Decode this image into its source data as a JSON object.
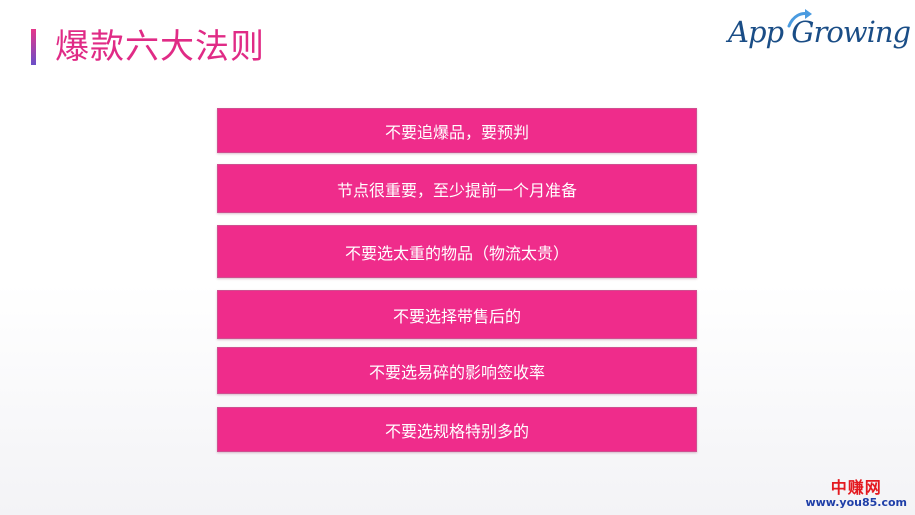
{
  "slide": {
    "title": "爆款六大法则"
  },
  "logo": {
    "text": "App Growing"
  },
  "rules": [
    "不要追爆品，要预判",
    "节点很重要，至少提前一个月准备",
    "不要选太重的物品（物流太贵）",
    "不要选择带售后的",
    "不要选易碎的影响签收率",
    "不要选规格特别多的"
  ],
  "watermark": {
    "site_name": "中赚网",
    "url": "www.you85.com"
  },
  "colors": {
    "accent": "#ef2c8b",
    "title": "#e02b86",
    "logo": "#1a4d86",
    "watermark_red": "#e4191f",
    "watermark_blue": "#1f3fa8"
  }
}
